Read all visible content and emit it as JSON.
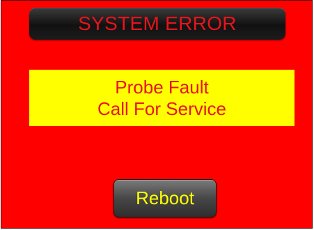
{
  "title": "SYSTEM ERROR",
  "message": {
    "line1": "Probe Fault",
    "line2": "Call For Service"
  },
  "reboot_button": {
    "label": "Reboot"
  },
  "colors": {
    "background": "#ff0000",
    "title_bar": "#1a1a1a",
    "title_text": "#e8141b",
    "message_box": "#ffff00",
    "message_text": "#e8141b",
    "button": "#474747",
    "button_text": "#ffff00"
  }
}
